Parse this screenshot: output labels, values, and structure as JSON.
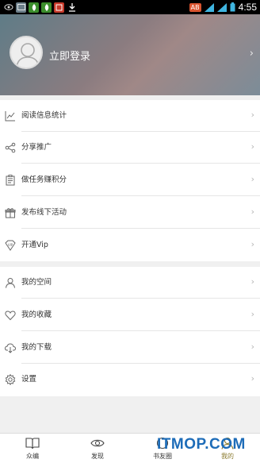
{
  "status_bar": {
    "badge": "AB",
    "time": "4:55",
    "left_icons": [
      "eye-icon",
      "photo-icon",
      "leaf-app-icon",
      "leaf-app-icon",
      "red-app-icon",
      "download-icon"
    ]
  },
  "header": {
    "login_label": "立即登录",
    "chevron": "›"
  },
  "menu_group_1": [
    {
      "label": "阅读信息统计",
      "icon": "stats-icon"
    },
    {
      "label": "分享推广",
      "icon": "share-icon"
    },
    {
      "label": "做任务赚积分",
      "icon": "task-icon"
    },
    {
      "label": "发布线下活动",
      "icon": "gift-icon"
    },
    {
      "label": "开通Vip",
      "icon": "vip-icon"
    }
  ],
  "menu_group_2": [
    {
      "label": "我的空间",
      "icon": "person-icon"
    },
    {
      "label": "我的收藏",
      "icon": "heart-icon"
    },
    {
      "label": "我的下载",
      "icon": "cloud-download-icon"
    },
    {
      "label": "设置",
      "icon": "gear-icon"
    }
  ],
  "bottom_nav": [
    {
      "label": "众编",
      "icon": "book-icon"
    },
    {
      "label": "发现",
      "icon": "eye-icon"
    },
    {
      "label": "书友圈",
      "icon": "circle-icon"
    },
    {
      "label": "我的",
      "icon": "person-icon"
    }
  ],
  "colors": {
    "accent_active_tab": "#8a7a2e",
    "watermark_blue": "#1d6cb8"
  },
  "watermark": "ITMOP.COM"
}
